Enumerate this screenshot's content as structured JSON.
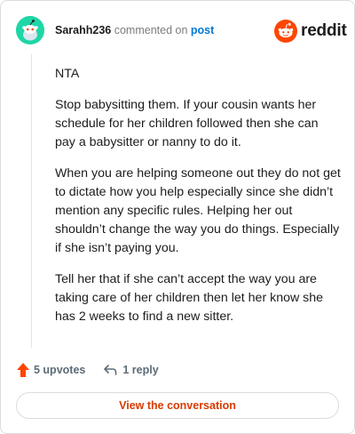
{
  "header": {
    "username": "Sarahh236",
    "commented_on_text": "commented on",
    "post_link_text": "post",
    "logo_text": "reddit"
  },
  "comment": {
    "paragraphs": [
      "NTA",
      "Stop babysitting them. If your cousin wants her schedule for her children followed then she can pay a babysitter or nanny to do it.",
      "When you are helping someone out they do not get to dictate how you help especially since she didn’t mention any specific rules. Helping her out shouldn’t change the way you do things. Especially if she isn’t paying you.",
      "Tell her that if she can’t accept the way you are taking care of her children then let her know she has 2 weeks to find a new sitter."
    ]
  },
  "actions": {
    "upvotes_label": "5 upvotes",
    "reply_label": "1 reply"
  },
  "footer": {
    "view_conversation_label": "View the conversation"
  },
  "colors": {
    "avatar_bg": "#1fd6a6",
    "reddit_orange": "#ff4500",
    "link_blue": "#0079d3",
    "cta_orange": "#d93a00"
  },
  "icons": [
    "snoo-avatar-icon",
    "reddit-logo-icon",
    "upvote-arrow-icon",
    "reply-arrow-icon"
  ]
}
